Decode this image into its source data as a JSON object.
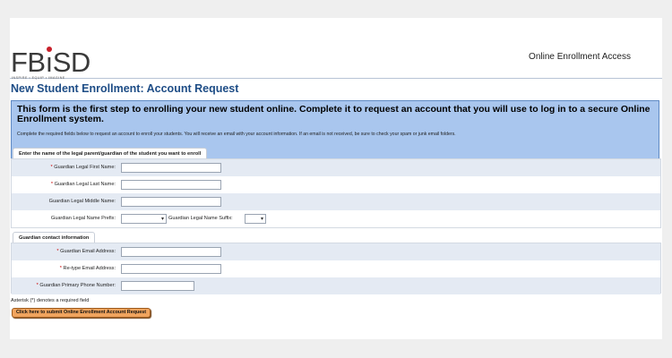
{
  "header": {
    "logo_text": "FBıSD",
    "logo_tagline": "INSPIRE • EQUIP • IMAGINE",
    "portal_title": "Online Enrollment Access"
  },
  "page_title": "New Student Enrollment: Account Request",
  "intro": {
    "heading": "This form is the first step to enrolling your new student online. Complete it to request an account that you will use to log in to a secure Online Enrollment system.",
    "text": "Complete the required fields below to request an account to enroll your students. You will receive an email with your account information. If an email is not received, be sure to check your spam or junk email folders."
  },
  "guardian_section": {
    "legend": "Enter the name of the legal parent/guardian of the student you want to enroll",
    "first_name_label": "Guardian Legal First Name:",
    "last_name_label": "Guardian Legal Last Name:",
    "middle_name_label": "Guardian Legal Middle Name:",
    "prefix_label": "Guardian Legal Name Prefix:",
    "suffix_label": "Guardian Legal Name Suffix:",
    "required_marker": "*",
    "first_name_value": "",
    "last_name_value": "",
    "middle_name_value": "",
    "prefix_value": "",
    "suffix_value": ""
  },
  "contact_section": {
    "legend": "Guardian contact information",
    "email_label": "Guardian Email Address:",
    "retype_email_label": "Re-type Email Address:",
    "phone_label": "Guardian Primary Phone Number:",
    "required_marker": "*",
    "email_value": "",
    "retype_email_value": "",
    "phone_value": ""
  },
  "footnote": "Asterisk (*) denotes a required field",
  "submit_label": "Click here to submit Online Enrollment Account Request",
  "colors": {
    "title_blue": "#1e4d86",
    "intro_bg": "#a9c6ee",
    "row_shade": "#e4eaf3",
    "required_red": "#cc0000",
    "button_orange": "#f0a45e"
  },
  "icons": {
    "select_arrow": "chevron-down-icon"
  }
}
